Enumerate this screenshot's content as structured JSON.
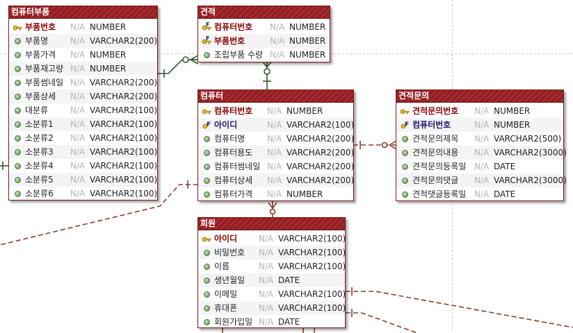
{
  "colors": {
    "header": "#8e1e22",
    "pk": "#8b0000",
    "fk": "#1a1a6e",
    "line": "#8b3a2a",
    "identifying_line": "#2e5a2e"
  },
  "icons": {
    "pk": "key-icon",
    "fk": "foreign-key-icon",
    "col": "column-dot-icon"
  },
  "entities": [
    {
      "title": "컴퓨터부품",
      "columns": [
        {
          "name": "부품번호",
          "null": "N/A",
          "type": "NUMBER",
          "kind": "pk"
        },
        {
          "name": "부품명",
          "null": "N/A",
          "type": "VARCHAR2(200)",
          "kind": "col"
        },
        {
          "name": "부품가격",
          "null": "N/A",
          "type": "NUMBER",
          "kind": "col"
        },
        {
          "name": "부품재고량",
          "null": "N/A",
          "type": "NUMBER",
          "kind": "col"
        },
        {
          "name": "부품썸네일",
          "null": "N/A",
          "type": "VARCHAR2(200)",
          "kind": "col"
        },
        {
          "name": "부품상세",
          "null": "N/A",
          "type": "VARCHAR2(200)",
          "kind": "col"
        },
        {
          "name": "대분류",
          "null": "N/A",
          "type": "VARCHAR2(100)",
          "kind": "col"
        },
        {
          "name": "소분류1",
          "null": "N/A",
          "type": "VARCHAR2(100)",
          "kind": "col"
        },
        {
          "name": "소분류2",
          "null": "N/A",
          "type": "VARCHAR2(100)",
          "kind": "col"
        },
        {
          "name": "소분류3",
          "null": "N/A",
          "type": "VARCHAR2(100)",
          "kind": "col"
        },
        {
          "name": "소분류4",
          "null": "N/A",
          "type": "VARCHAR2(100)",
          "kind": "col"
        },
        {
          "name": "소분류5",
          "null": "N/A",
          "type": "VARCHAR2(100)",
          "kind": "col"
        },
        {
          "name": "소분류6",
          "null": "N/A",
          "type": "VARCHAR2(100)",
          "kind": "col"
        }
      ]
    },
    {
      "title": "견적",
      "columns": [
        {
          "name": "컴퓨터번호",
          "null": "N/A",
          "type": "NUMBER",
          "kind": "pkfk"
        },
        {
          "name": "부품번호",
          "null": "N/A",
          "type": "NUMBER",
          "kind": "pkfk"
        },
        {
          "name": "조립부품 수량",
          "null": "N/A",
          "type": "NUMBER",
          "kind": "col"
        }
      ]
    },
    {
      "title": "컴퓨터",
      "columns": [
        {
          "name": "컴퓨터번호",
          "null": "N/A",
          "type": "NUMBER",
          "kind": "pk"
        },
        {
          "name": "아이디",
          "null": "N/A",
          "type": "VARCHAR2(100)",
          "kind": "fk"
        },
        {
          "name": "컴퓨터명",
          "null": "N/A",
          "type": "VARCHAR2(200)",
          "kind": "col"
        },
        {
          "name": "컴퓨터용도",
          "null": "N/A",
          "type": "VARCHAR2(200)",
          "kind": "col"
        },
        {
          "name": "컴퓨터썸네일",
          "null": "N/A",
          "type": "VARCHAR2(200)",
          "kind": "col"
        },
        {
          "name": "컴퓨터상세",
          "null": "N/A",
          "type": "VARCHAR2(200)",
          "kind": "col"
        },
        {
          "name": "컴퓨터가격",
          "null": "N/A",
          "type": "NUMBER",
          "kind": "col"
        }
      ]
    },
    {
      "title": "견적문의",
      "columns": [
        {
          "name": "견적문의번호",
          "null": "N/A",
          "type": "NUMBER",
          "kind": "pk"
        },
        {
          "name": "컴퓨터번호",
          "null": "N/A",
          "type": "NUMBER",
          "kind": "fk"
        },
        {
          "name": "견적문의제목",
          "null": "N/A",
          "type": "VARCHAR2(500)",
          "kind": "col"
        },
        {
          "name": "견적문의내용",
          "null": "N/A",
          "type": "VARCHAR2(3000)",
          "kind": "col"
        },
        {
          "name": "견적문의등록일",
          "null": "N/A",
          "type": "DATE",
          "kind": "col"
        },
        {
          "name": "견적문의댓글",
          "null": "N/A",
          "type": "VARCHAR2(3000)",
          "kind": "col"
        },
        {
          "name": "견적댓글등록일",
          "null": "N/A",
          "type": "DATE",
          "kind": "col"
        }
      ]
    },
    {
      "title": "회원",
      "columns": [
        {
          "name": "아이디",
          "null": "N/A",
          "type": "VARCHAR2(100)",
          "kind": "pk"
        },
        {
          "name": "비밀번호",
          "null": "N/A",
          "type": "VARCHAR2(100)",
          "kind": "col"
        },
        {
          "name": "이름",
          "null": "N/A",
          "type": "VARCHAR2(100)",
          "kind": "col"
        },
        {
          "name": "생년월일",
          "null": "N/A",
          "type": "DATE",
          "kind": "col"
        },
        {
          "name": "이메일",
          "null": "N/A",
          "type": "VARCHAR2(100)",
          "kind": "col"
        },
        {
          "name": "휴대폰",
          "null": "N/A",
          "type": "VARCHAR2(100)",
          "kind": "col"
        },
        {
          "name": "회원가입일",
          "null": "N/A",
          "type": "DATE",
          "kind": "col"
        }
      ]
    }
  ]
}
